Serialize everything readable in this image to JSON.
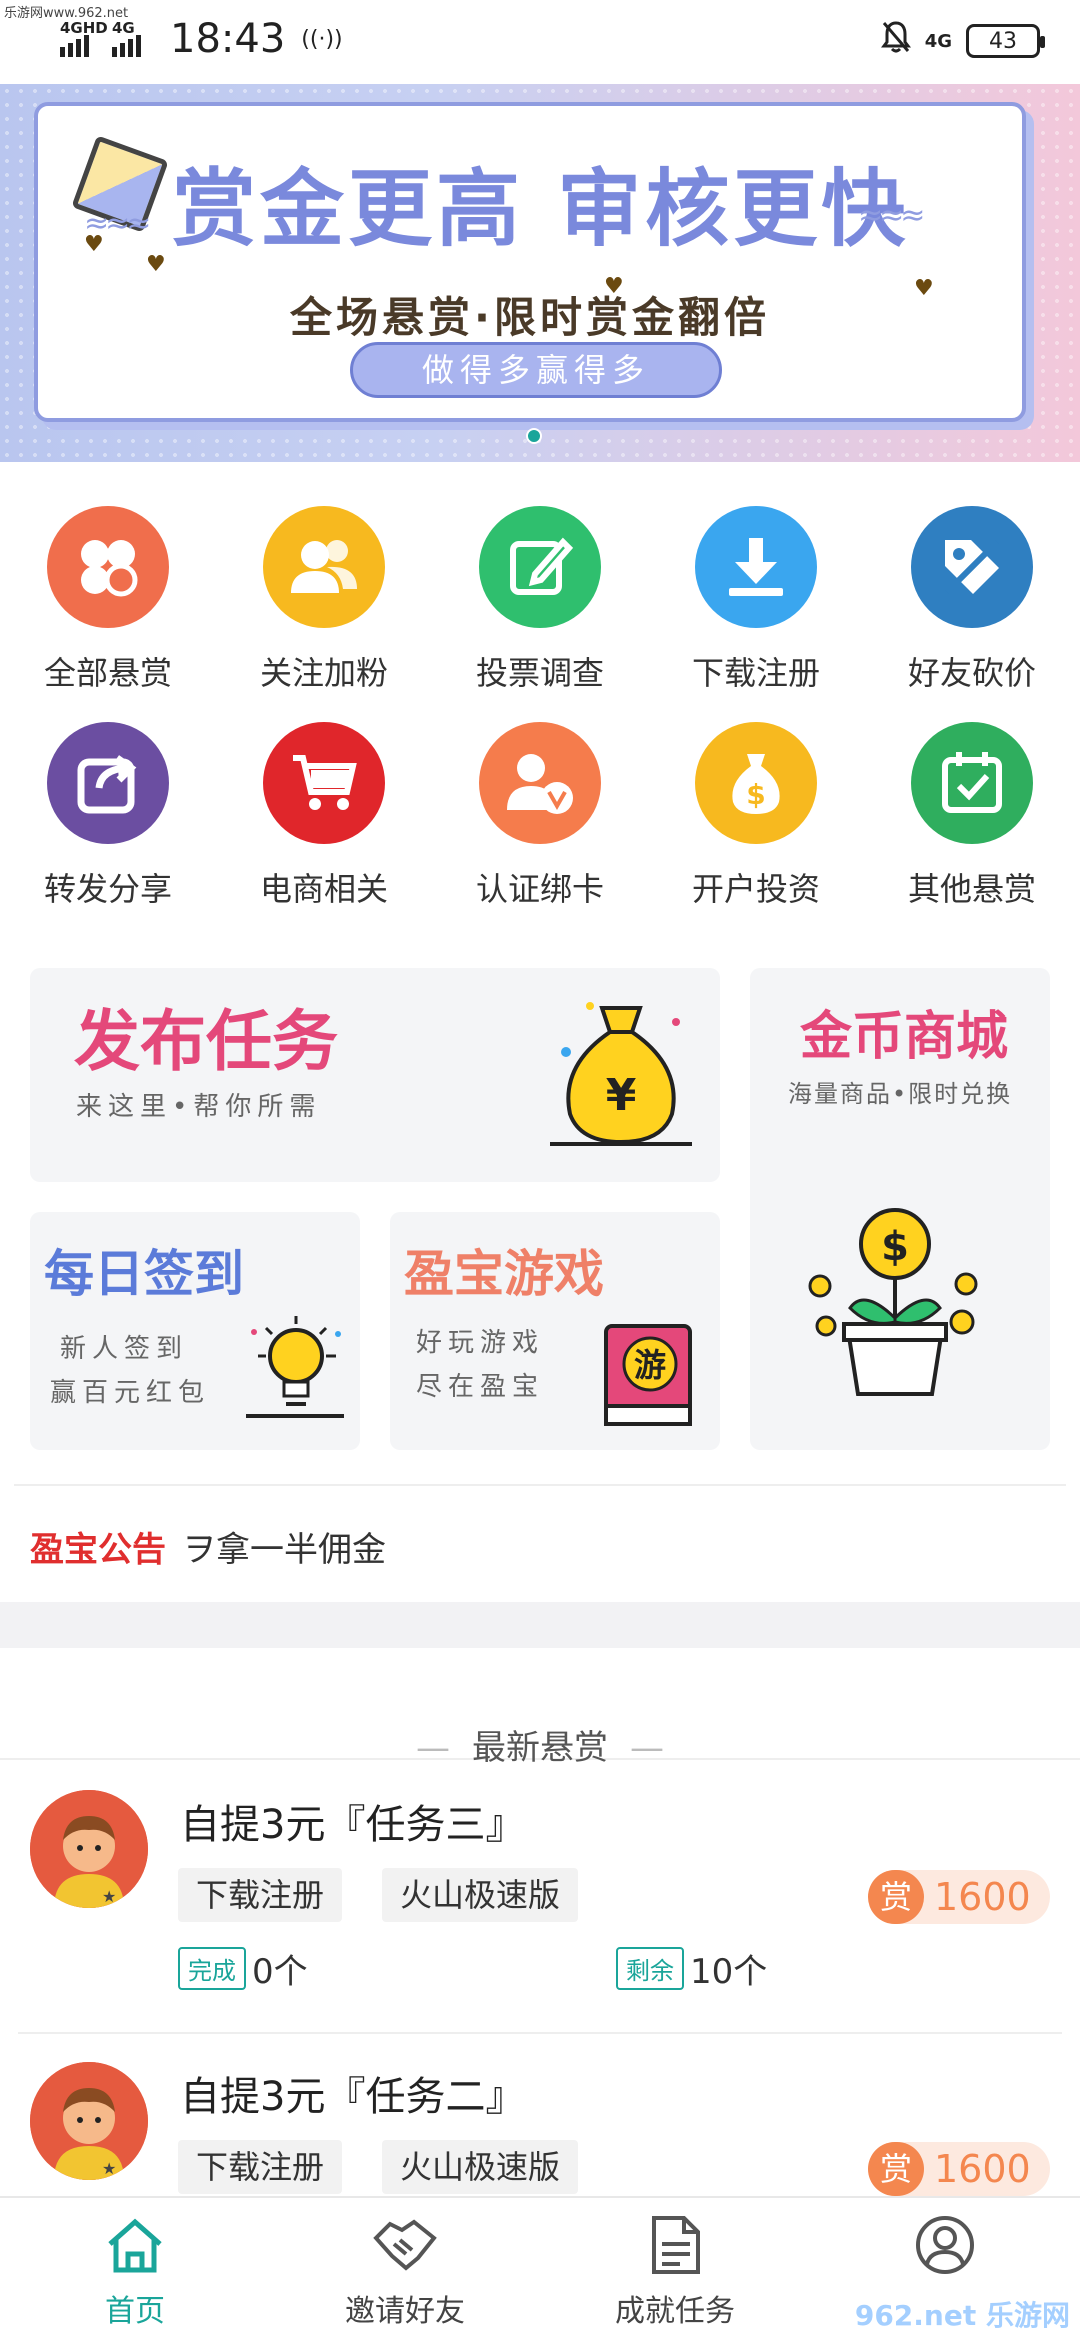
{
  "status_bar": {
    "watermark": "乐游网www.962.net",
    "signal1": "4GHD",
    "signal2": "4G",
    "time": "18:43",
    "hotspot_glyph": "((·))",
    "network": "4G",
    "battery": "43"
  },
  "banner": {
    "headline": "赏金更高 审核更快",
    "subline": "全场悬赏·限时赏金翻倍",
    "pill": "做得多赢得多"
  },
  "categories": [
    {
      "label": "全部悬赏",
      "color": "#f06e4c",
      "icon": "clover-icon"
    },
    {
      "label": "关注加粉",
      "color": "#f7b91f",
      "icon": "users-icon"
    },
    {
      "label": "投票调查",
      "color": "#2fbf6e",
      "icon": "edit-icon"
    },
    {
      "label": "下载注册",
      "color": "#3aa6ef",
      "icon": "download-icon"
    },
    {
      "label": "好友砍价",
      "color": "#2f7fc1",
      "icon": "tag-icon"
    },
    {
      "label": "转发分享",
      "color": "#6b4ea1",
      "icon": "share-icon"
    },
    {
      "label": "电商相关",
      "color": "#e0262b",
      "icon": "cart-icon"
    },
    {
      "label": "认证绑卡",
      "color": "#f57c4c",
      "icon": "verify-user-icon"
    },
    {
      "label": "开户投资",
      "color": "#f7b91f",
      "icon": "money-bag-icon"
    },
    {
      "label": "其他悬赏",
      "color": "#2fae5e",
      "icon": "calendar-check-icon"
    }
  ],
  "promos": {
    "publish": {
      "title": "发布任务",
      "desc": "来这里•帮你所需",
      "glyph": "¥"
    },
    "shop": {
      "title": "金币商城",
      "desc": "海量商品•限时兑换",
      "glyph": "$"
    },
    "checkin": {
      "title": "每日签到",
      "desc1": "新人签到",
      "desc2": "赢百元红包"
    },
    "games": {
      "title": "盈宝游戏",
      "desc1": "好玩游戏",
      "desc2": "尽在盈宝",
      "glyph": "游"
    }
  },
  "notice": {
    "title": "盈宝公告",
    "text": "ヲ拿一半佣金"
  },
  "section": {
    "title": "最新悬赏",
    "dash": "—"
  },
  "tasks": [
    {
      "title": "自提3元『任务三』",
      "tag1": "下载注册",
      "tag2": "火山极速版",
      "reward_icon": "赏",
      "reward": "1600",
      "done_label": "完成",
      "done_value": "0个",
      "left_label": "剩余",
      "left_value": "10个"
    },
    {
      "title": "自提3元『任务二』",
      "tag1": "下载注册",
      "tag2": "火山极速版",
      "reward_icon": "赏",
      "reward": "1600"
    }
  ],
  "bottom_nav": [
    {
      "label": "首页",
      "icon": "home-icon",
      "active": true
    },
    {
      "label": "邀请好友",
      "icon": "handshake-icon",
      "active": false
    },
    {
      "label": "成就任务",
      "icon": "document-icon",
      "active": false
    },
    {
      "label": "",
      "icon": "profile-icon",
      "active": false
    }
  ],
  "corner_watermark": "962.net 乐游网"
}
